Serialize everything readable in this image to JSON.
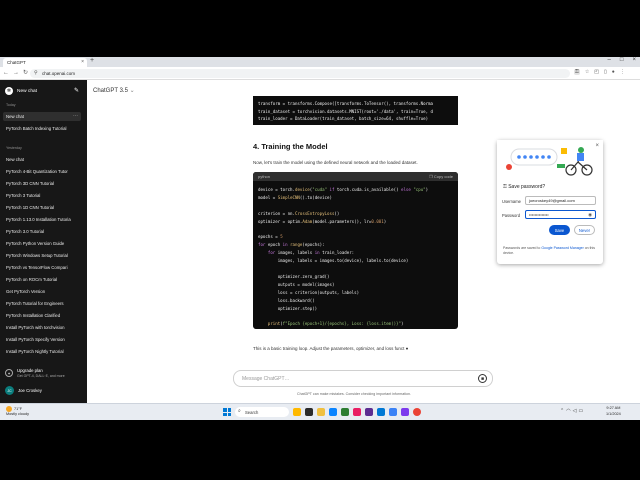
{
  "browser": {
    "tab_title": "ChatGPT",
    "new_tab": "+",
    "url": "chat.openai.com",
    "window_controls": [
      "–",
      "□",
      "×"
    ]
  },
  "sidebar": {
    "new_chat": "New chat",
    "today_label": "Today",
    "today_items": [
      "New chat",
      "PyTorch Batch Indexing Tutorial"
    ],
    "yesterday_label": "Yesterday",
    "yesterday_items": [
      "New chat",
      "PyTorch 4-Bit Quantization Tutor",
      "PyTorch 3D CNN Tutorial",
      "PyTorch 3 Tutorial",
      "PyTorch 1D CNN Tutorial",
      "PyTorch 1.13.0 Installation Tutoria",
      "PyTorch 3.0 Tutorial",
      "PyTorch Python Version Guide",
      "PyTorch Windows Setup Tutorial",
      "PyTorch vs TensorFlow Compari",
      "PyTorch on ROCm Tutorial",
      "Get PyTorch Version",
      "PyTorch Tutorial for Engineers",
      "PyTorch Installation Clarified",
      "Install PyTorch with torchvision",
      "Install PyTorch Specify Version",
      "Install PyTorch Nightly Tutorial"
    ],
    "upgrade_title": "Upgrade plan",
    "upgrade_sub": "Get GPT-4, DALL·E, and more",
    "user_name": "Joe Croskey",
    "user_initials": "JC"
  },
  "main": {
    "model": "ChatGPT 3.5",
    "model_chevron": "⌄",
    "code1": [
      "transform = transforms.Compose([transforms.ToTensor(), transforms.Norma",
      "train_dataset = torchvision.datasets.MNIST(root='./data', train=True, d",
      "train_loader = DataLoader(train_dataset, batch_size=64, shuffle=True)"
    ],
    "heading": "4. Training the Model",
    "para1": "Now, let's train the model using the defined neural network and the loaded dataset.",
    "code2_lang": "python",
    "code2_copy": "Copy code",
    "para2": "This is a basic training loop. Adjust the parameters, optimizer, and loss funct",
    "input_placeholder": "Message ChatGPT…",
    "disclaimer": "ChatGPT can make mistakes. Consider checking important information.",
    "help": "?"
  },
  "password_popup": {
    "title": "Save password?",
    "username_label": "Username",
    "username_value": "joecroskey49@gmail.com",
    "password_label": "Password",
    "password_value": "••••••••••••••",
    "save_label": "Save",
    "never_label": "Never",
    "note_prefix": "Passwords are saved to ",
    "note_link": "Google Password Manager",
    "note_suffix": " on this device.",
    "close": "×"
  },
  "taskbar": {
    "weather_temp": "71°F",
    "weather_desc": "Mostly cloudy",
    "search_label": "Search",
    "time": "9:27 AM",
    "date": "1/1/2024"
  },
  "colors": {
    "sidebar_bg": "#171717",
    "code_bg": "#0d0d0d",
    "accent_blue": "#0b57d0"
  }
}
